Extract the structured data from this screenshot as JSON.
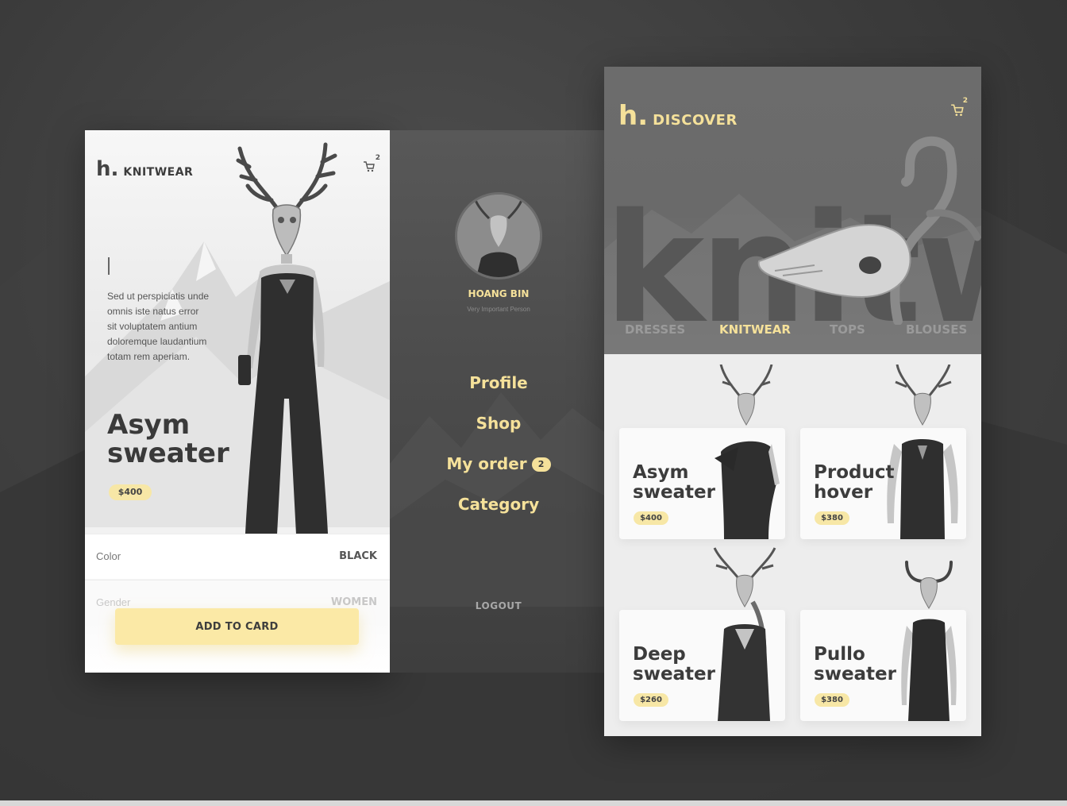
{
  "product_screen": {
    "brand_mark": "h.",
    "brand_word": "KNITWEAR",
    "cart_count": "2",
    "description": "Sed ut perspiciatis unde omnis iste natus error sit voluptatem antium doloremque laudantium totam rem aperiam.",
    "title": "Asym sweater",
    "price": "$400",
    "attributes": [
      {
        "label": "Color",
        "value": "BLACK"
      },
      {
        "label": "Gender",
        "value": "WOMEN"
      }
    ],
    "add_button_label": "ADD TO CARD"
  },
  "menu_screen": {
    "user_name": "HOANG BIN",
    "user_role": "Very Important Person",
    "nav": [
      {
        "label": "Profile"
      },
      {
        "label": "Shop"
      },
      {
        "label": "My order",
        "badge": "2"
      },
      {
        "label": "Category"
      }
    ],
    "logout_label": "LOGOUT"
  },
  "discover_screen": {
    "brand_mark": "h.",
    "brand_word": "DISCOVER",
    "cart_count": "2",
    "hero_word": "knitw",
    "tabs": [
      {
        "label": "DRESSES",
        "active": false
      },
      {
        "label": "KNITWEAR",
        "active": true
      },
      {
        "label": "TOPS",
        "active": false
      },
      {
        "label": "BLOUSES",
        "active": false
      }
    ],
    "products": [
      {
        "title": "Asym sweater",
        "price": "$400"
      },
      {
        "title": "Product hover",
        "price": "$380"
      },
      {
        "title": "Deep sweater",
        "price": "$260"
      },
      {
        "title": "Pullo sweater",
        "price": "$380"
      }
    ]
  },
  "colors": {
    "accent": "#f5e19a",
    "price_pill": "#f7e7a6",
    "button": "#fbe9a6",
    "dark_panel": "#4d4d4d"
  }
}
